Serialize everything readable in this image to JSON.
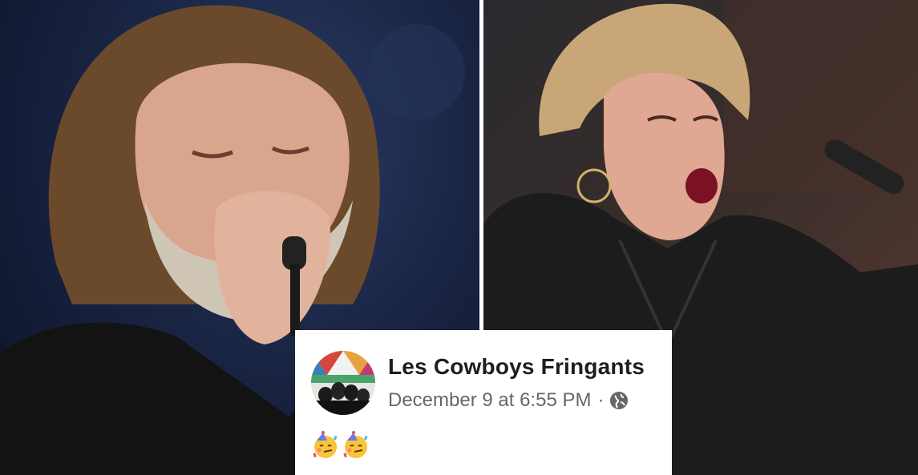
{
  "post": {
    "page_name": "Les Cowboys Fringants",
    "timestamp": "December 9 at 6:55 PM",
    "separator": "·",
    "privacy_icon": "globe-icon",
    "content_emojis": [
      "partying-face-emoji",
      "partying-face-emoji"
    ]
  },
  "photos": [
    {
      "subject": "male-singer-with-microphone"
    },
    {
      "subject": "female-singer-in-leather-jacket"
    }
  ],
  "colors": {
    "card_background": "#ffffff",
    "name_text": "#1c1e21",
    "meta_text": "#65676b"
  }
}
